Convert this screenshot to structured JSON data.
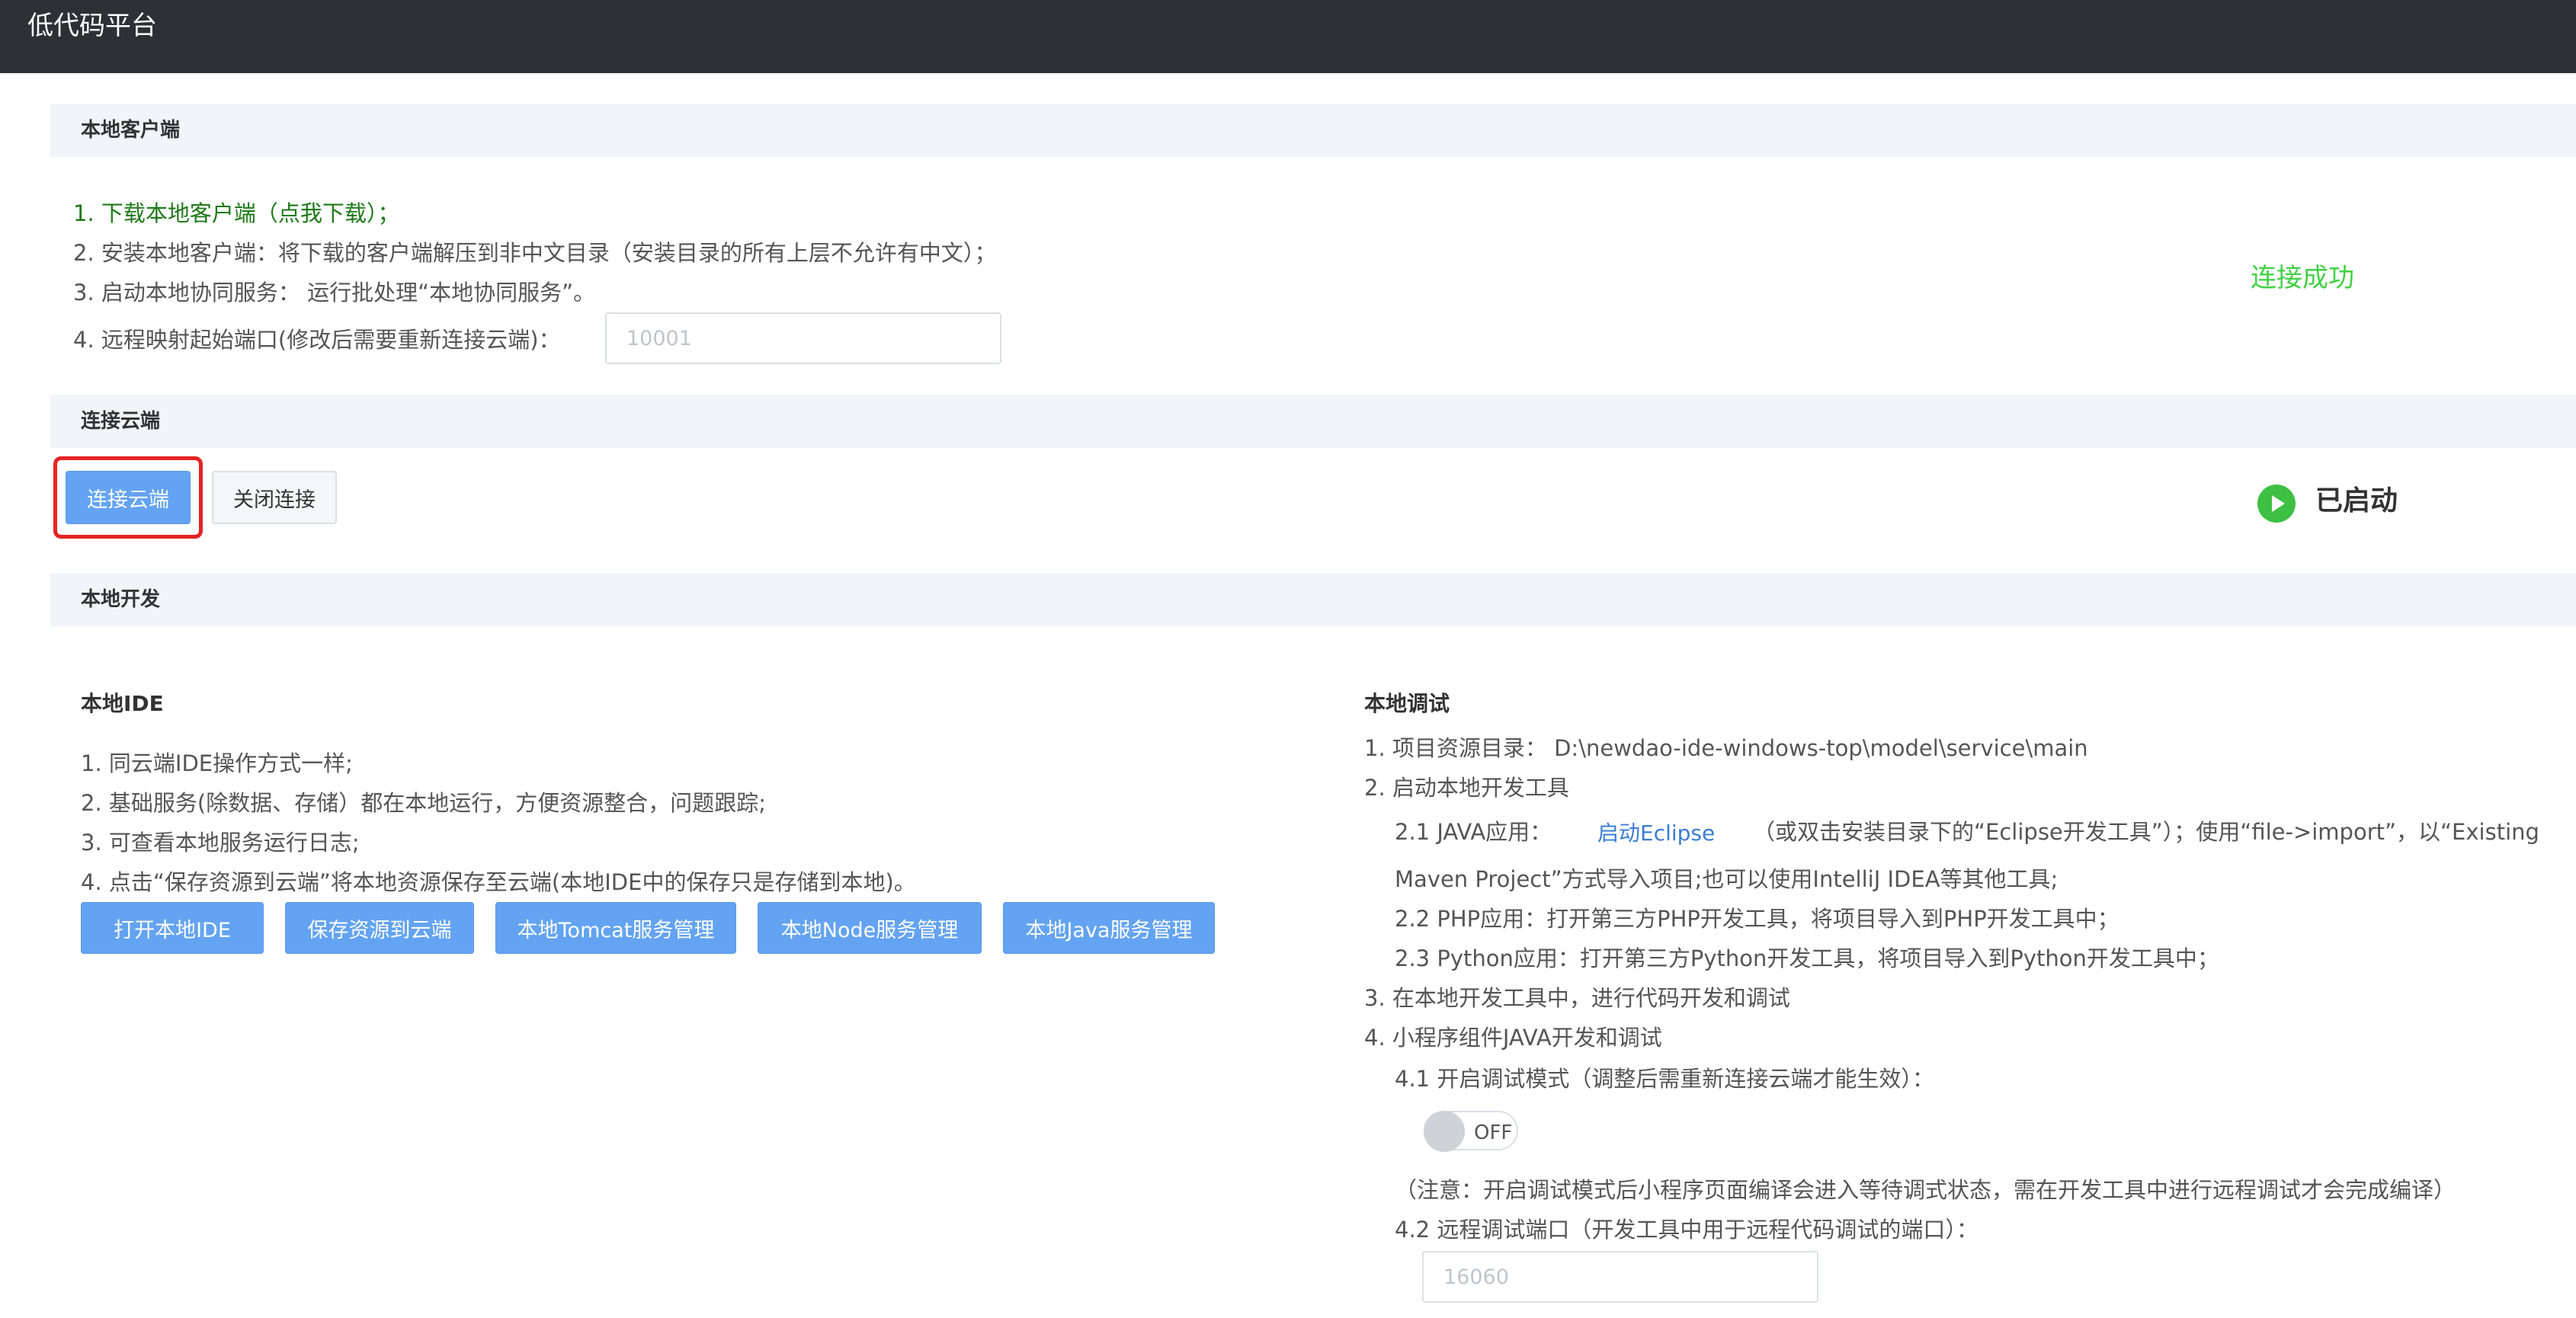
{
  "app": {
    "title": "低代码平台"
  },
  "local_client": {
    "header": "本地客户端",
    "step1": "1. 下载本地客户端（点我下载）；",
    "step2": "2. 安装本地客户端：将下载的客户端解压到非中文目录（安装目录的所有上层不允许有中文）；",
    "step3": "3. 启动本地协同服务： 运行批处理“本地协同服务”。",
    "step4_label": "4. 远程映射起始端口(修改后需要重新连接云端)：",
    "port_value": "10001",
    "status": "连接成功"
  },
  "cloud": {
    "header": "连接云端",
    "connect_label": "连接云端",
    "close_label": "关闭连接",
    "status_label": "已启动",
    "status_color": "#3ec043"
  },
  "local_dev": {
    "header": "本地开发",
    "ide": {
      "title": "本地IDE",
      "items": [
        "1. 同云端IDE操作方式一样;",
        "2. 基础服务(除数据、存储）都在本地运行，方便资源整合，问题跟踪;",
        "3. 可查看本地服务运行日志;",
        "4. 点击“保存资源到云端”将本地资源保存至云端(本地IDE中的保存只是存储到本地)。"
      ],
      "buttons": {
        "open_ide": "打开本地IDE",
        "save_cloud": "保存资源到云端",
        "tomcat": "本地Tomcat服务管理",
        "node": "本地Node服务管理",
        "java": "本地Java服务管理"
      }
    },
    "debug": {
      "title": "本地调试",
      "l1": "1. 项目资源目录： D:\\newdao-ide-windows-top\\model\\service\\main",
      "l2": "2. 启动本地开发工具",
      "l21_prefix": "2.1 JAVA应用：",
      "l21_link": "启动Eclipse",
      "l21_suffix": "（或双击安装目录下的“Eclipse开发工具”）；使用“file->import”，以“Existing",
      "l21_cont": "Maven Project”方式导入项目;也可以使用IntelliJ IDEA等其他工具;",
      "l22": "2.2 PHP应用：打开第三方PHP开发工具，将项目导入到PHP开发工具中；",
      "l23": "2.3 Python应用：打开第三方Python开发工具，将项目导入到Python开发工具中；",
      "l3": "3. 在本地开发工具中，进行代码开发和调试",
      "l4": "4. 小程序组件JAVA开发和调试",
      "l41": "4.1 开启调试模式（调整后需重新连接云端才能生效）：",
      "toggle_label": "OFF",
      "note": "（注意：开启调试模式后小程序页面编译会进入等待调式状态，需在开发工具中进行远程调试才会完成编译）",
      "l42": "4.2 远程调试端口（开发工具中用于远程代码调试的端口）：",
      "debug_port": "16060"
    }
  }
}
